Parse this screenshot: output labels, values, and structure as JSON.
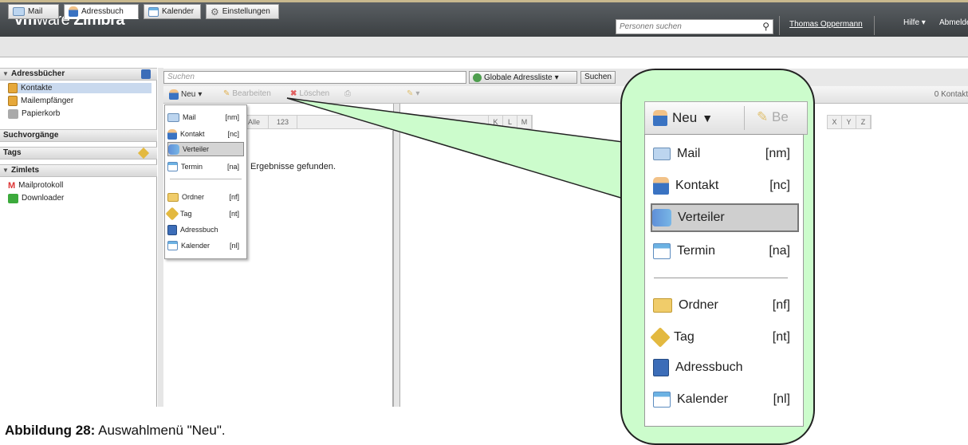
{
  "header": {
    "logo_vm": "vm",
    "logo_ware": "ware",
    "logo_zimbra": " Zimbra",
    "people_search_placeholder": "Personen suchen",
    "user": "Thomas Oppermann",
    "help": "Hilfe",
    "logout": "Abmelden"
  },
  "app_tabs": [
    {
      "label": "Mail",
      "icon": "mail-icon"
    },
    {
      "label": "Adressbuch",
      "icon": "person-icon"
    },
    {
      "label": "Kalender",
      "icon": "calendar-icon"
    },
    {
      "label": "Einstellungen",
      "icon": "gear-icon"
    }
  ],
  "sidebar": {
    "addressbooks_header": "Adressbücher",
    "items": [
      "Kontakte",
      "Mailempfänger",
      "Papierkorb"
    ],
    "searches_header": "Suchvorgänge",
    "tags_header": "Tags",
    "zimlets_header": "Zimlets",
    "zimlets": [
      "Mailprotokoll",
      "Downloader"
    ]
  },
  "search": {
    "placeholder": "Suchen",
    "gal": "Globale Adressliste",
    "button": "Suchen"
  },
  "toolbar": {
    "new": "Neu",
    "edit": "Bearbeiten",
    "delete": "Löschen",
    "count": "0 Kontakt"
  },
  "alphabet": {
    "all": "Alle",
    "num": "123",
    "left_letters": [
      "K",
      "L",
      "M"
    ],
    "right_letters": [
      "X",
      "Y",
      "Z"
    ]
  },
  "list": {
    "no_results": "Ergebnisse gefunden."
  },
  "new_menu": {
    "items": [
      {
        "label": "Mail",
        "shortcut": "[nm]"
      },
      {
        "label": "Kontakt",
        "shortcut": "[nc]"
      },
      {
        "label": "Verteiler",
        "shortcut": ""
      },
      {
        "label": "Termin",
        "shortcut": "[na]"
      },
      {
        "label": "Ordner",
        "shortcut": "[nf]"
      },
      {
        "label": "Tag",
        "shortcut": "[nt]"
      },
      {
        "label": "Adressbuch",
        "shortcut": ""
      },
      {
        "label": "Kalender",
        "shortcut": "[nl]"
      }
    ]
  },
  "zoom": {
    "new": "Neu",
    "edit_partial": "Be"
  },
  "caption": {
    "bold": "Abbildung 28:",
    "text": " Auswahlmenü \"Neu\"."
  }
}
